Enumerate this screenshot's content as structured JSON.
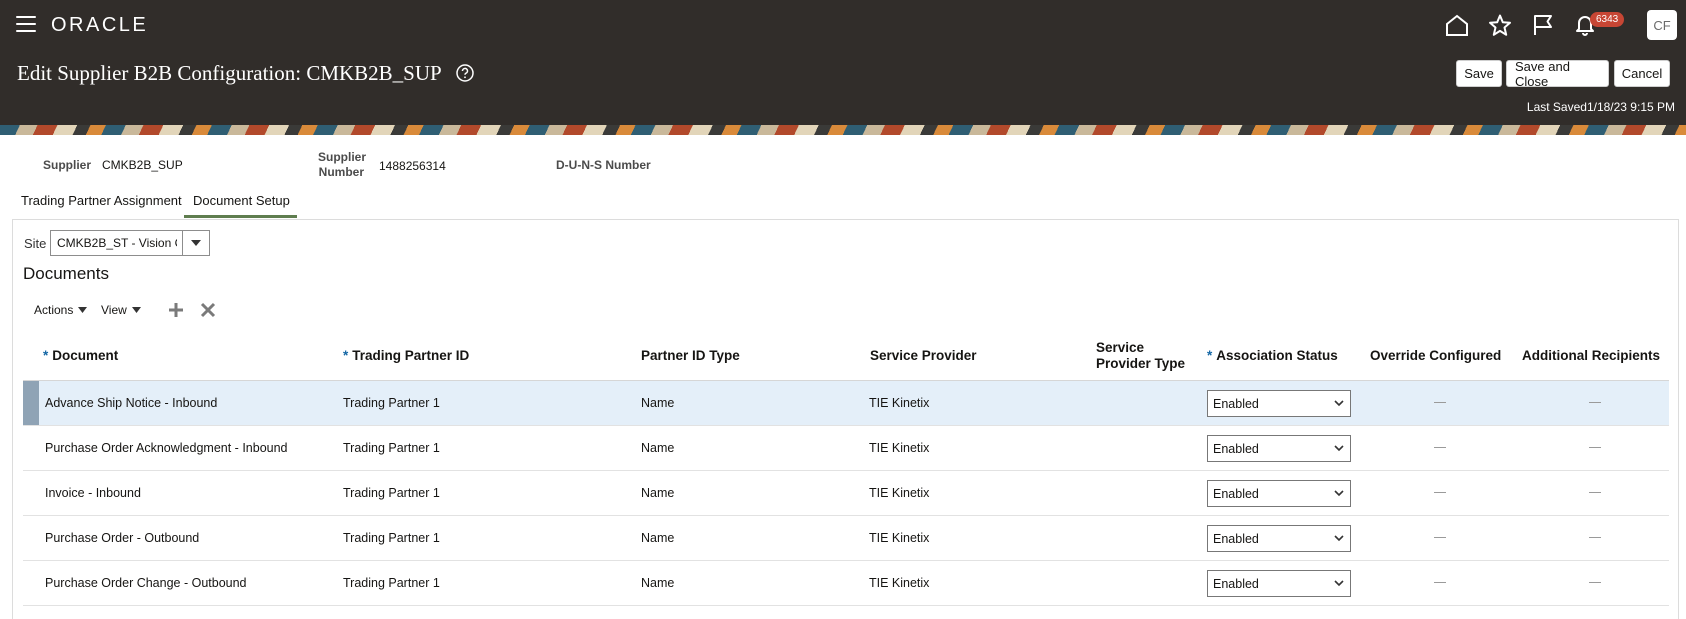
{
  "header": {
    "brand": "ORACLE",
    "notification_count": "6343",
    "avatar_initials": "CF",
    "page_title": "Edit Supplier B2B Configuration: CMKB2B_SUP",
    "save_label": "Save",
    "save_close_label": "Save and Close",
    "cancel_label": "Cancel",
    "last_saved_label": "Last Saved",
    "last_saved_value": "1/18/23 9:15 PM"
  },
  "supplier_info": {
    "supplier_label": "Supplier",
    "supplier_value": "CMKB2B_SUP",
    "supplier_number_label_1": "Supplier",
    "supplier_number_label_2": "Number",
    "supplier_number_value": "1488256314",
    "duns_label": "D-U-N-S Number"
  },
  "tabs": [
    {
      "label": "Trading Partner Assignment",
      "active": false
    },
    {
      "label": "Document Setup",
      "active": true
    }
  ],
  "site": {
    "label": "Site",
    "value": "CMKB2B_ST - Vision C"
  },
  "documents": {
    "title": "Documents",
    "toolbar": {
      "actions_label": "Actions",
      "view_label": "View"
    },
    "columns": {
      "document": "Document",
      "trading_partner_id": "Trading Partner ID",
      "partner_id_type": "Partner ID Type",
      "service_provider": "Service Provider",
      "service_provider_type_1": "Service",
      "service_provider_type_2": "Provider Type",
      "association_status": "Association Status",
      "override_configured": "Override Configured",
      "additional_recipients": "Additional Recipients"
    },
    "rows": [
      {
        "document": "Advance Ship Notice - Inbound",
        "trading_partner_id": "Trading Partner 1",
        "partner_id_type": "Name",
        "service_provider": "TIE Kinetix",
        "association_status": "Enabled"
      },
      {
        "document": "Purchase Order Acknowledgment - Inbound",
        "trading_partner_id": "Trading Partner 1",
        "partner_id_type": "Name",
        "service_provider": "TIE Kinetix",
        "association_status": "Enabled"
      },
      {
        "document": "Invoice - Inbound",
        "trading_partner_id": "Trading Partner 1",
        "partner_id_type": "Name",
        "service_provider": "TIE Kinetix",
        "association_status": "Enabled"
      },
      {
        "document": "Purchase Order - Outbound",
        "trading_partner_id": "Trading Partner 1",
        "partner_id_type": "Name",
        "service_provider": "TIE Kinetix",
        "association_status": "Enabled"
      },
      {
        "document": "Purchase Order Change - Outbound",
        "trading_partner_id": "Trading Partner 1",
        "partner_id_type": "Name",
        "service_provider": "TIE Kinetix",
        "association_status": "Enabled"
      }
    ]
  },
  "colors": {
    "header_bg": "#312d2a",
    "badge": "#c74634",
    "selected_row": "#e4eff9",
    "tab_underline": "#5f7d4f",
    "required_marker": "#1467a5"
  }
}
